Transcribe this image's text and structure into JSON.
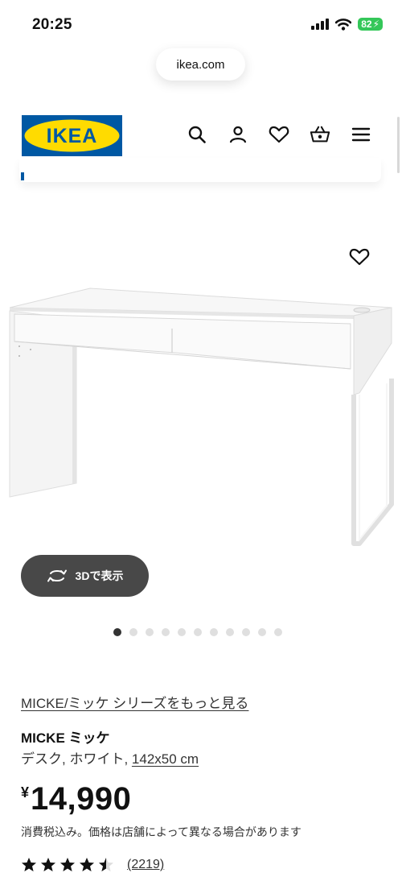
{
  "status_bar": {
    "time": "20:25",
    "battery": "82"
  },
  "browser": {
    "url": "ikea.com"
  },
  "header": {
    "logo_text": "IKEA",
    "brand_colors": {
      "blue": "#0058a3",
      "yellow": "#ffdb00"
    },
    "icons": [
      "search-icon",
      "account-icon",
      "favorites-icon",
      "cart-icon",
      "menu-icon"
    ]
  },
  "gallery": {
    "button_3d_label": "3Dで表示",
    "image_count": 11,
    "active_index": 0
  },
  "product": {
    "series_link": "MICKE/ミッケ シリーズをもっと見る",
    "name": "MICKE ミッケ",
    "description": "デスク, ホワイト, ",
    "dimensions": "142x50 cm",
    "currency": "¥",
    "price": "14,990",
    "tax_note": "消費税込み。価格は店舗によって異なる場合があります",
    "rating": 4.5,
    "rating_max": 5,
    "review_count": "(2219)"
  }
}
